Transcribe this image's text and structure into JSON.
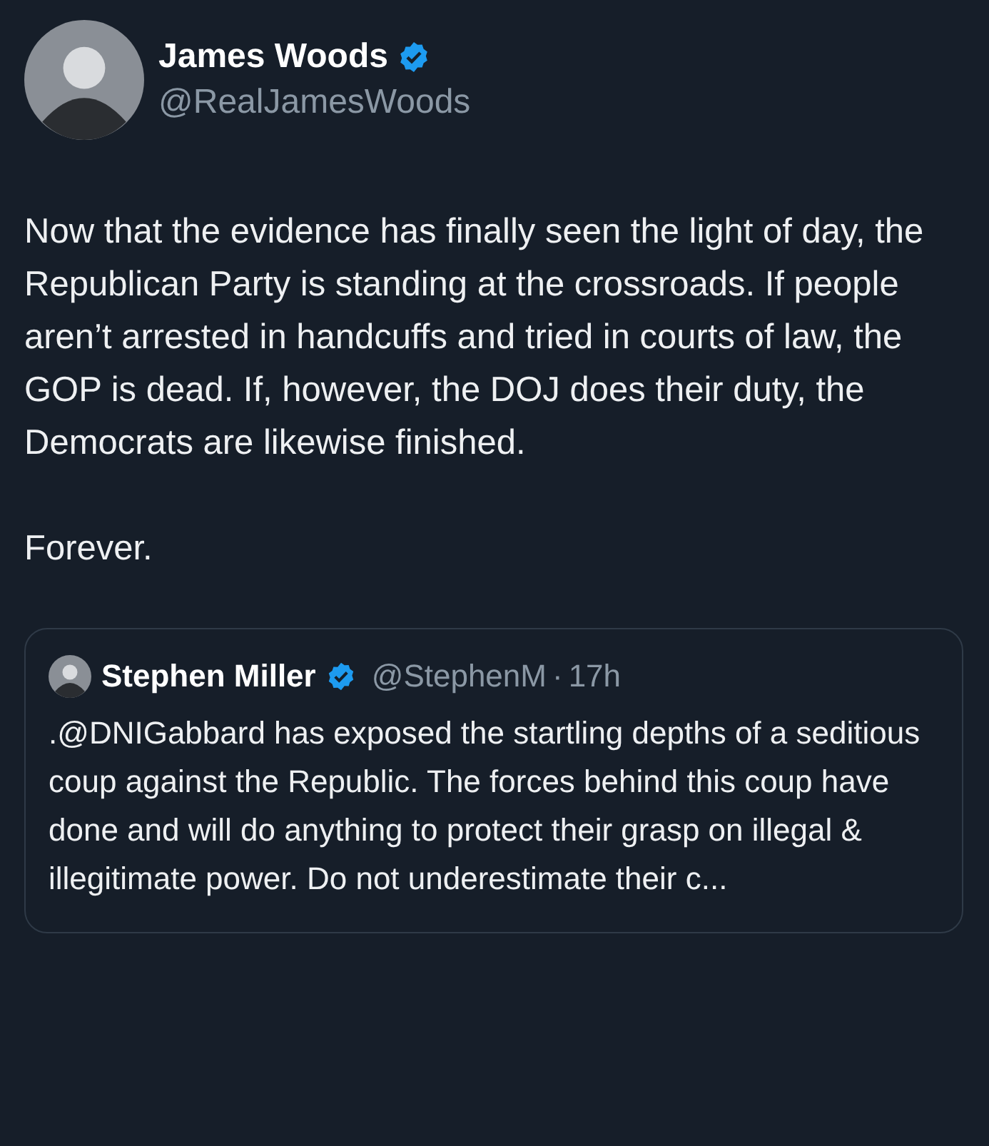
{
  "tweet": {
    "author": {
      "name": "James Woods",
      "handle": "@RealJamesWoods",
      "verified": true
    },
    "paragraphs": [
      "Now that the evidence has finally seen the light of day, the Republican Party is standing at the crossroads. If people aren’t arrested in handcuffs and tried in courts of law, the GOP is dead. If, however, the DOJ does their duty, the Democrats are likewise finished.",
      "Forever."
    ],
    "quoted_tweet": {
      "author": {
        "name": "Stephen Miller",
        "handle": "@StephenM",
        "verified": true
      },
      "separator": "·",
      "time": "17h",
      "text": ".@DNIGabbard has exposed the startling depths of a seditious coup against the Republic. The forces behind this coup have done and will do anything to protect their grasp on illegal & illegitimate power. Do not underestimate their c..."
    }
  }
}
